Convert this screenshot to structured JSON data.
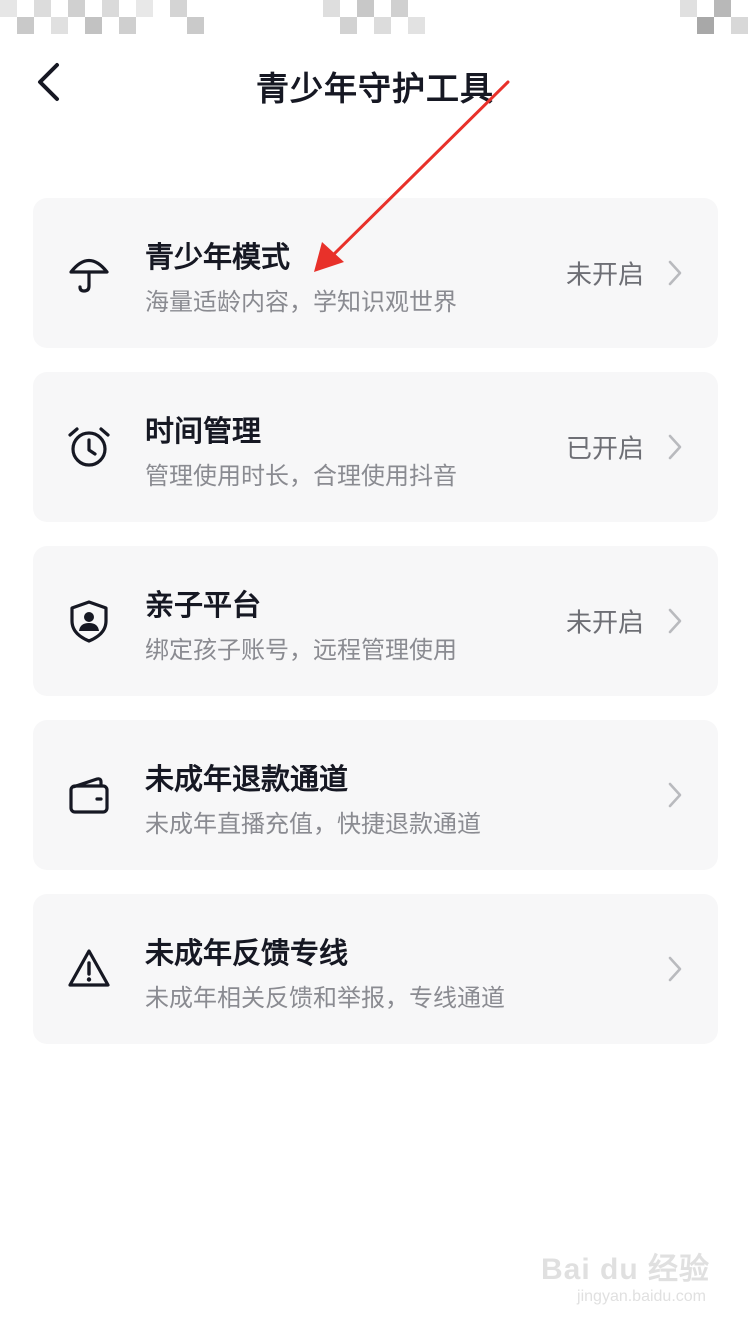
{
  "header": {
    "title": "青少年守护工具"
  },
  "cards": [
    {
      "title": "青少年模式",
      "description": "海量适龄内容，学知识观世界",
      "status": "未开启",
      "icon": "umbrella-icon"
    },
    {
      "title": "时间管理",
      "description": "管理使用时长，合理使用抖音",
      "status": "已开启",
      "icon": "alarm-clock-icon"
    },
    {
      "title": "亲子平台",
      "description": "绑定孩子账号，远程管理使用",
      "status": "未开启",
      "icon": "shield-user-icon"
    },
    {
      "title": "未成年退款通道",
      "description": "未成年直播充值，快捷退款通道",
      "status": "",
      "icon": "wallet-icon"
    },
    {
      "title": "未成年反馈专线",
      "description": "未成年相关反馈和举报，专线通道",
      "status": "",
      "icon": "warning-icon"
    }
  ],
  "watermark": {
    "logo": "Bai du 经验",
    "url": "jingyan.baidu.com"
  },
  "colors": {
    "card_background": "#f7f7f8",
    "title_text": "#161823",
    "secondary_text": "#8a8b91",
    "annotation_arrow": "#e8312a"
  }
}
